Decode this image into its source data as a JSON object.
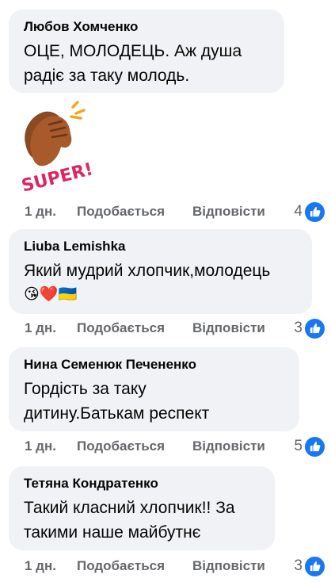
{
  "comments": [
    {
      "author": "Любов Хомченко",
      "text": "ОЦЕ, МОЛОДЕЦЬ. Аж душа радіє за таку молодь.",
      "sticker_text": "SUPER!",
      "time": "1 дн.",
      "like": "Подобається",
      "reply": "Відповісти",
      "reactions": "4"
    },
    {
      "author": "Liuba Lemishka",
      "text": "Який мудрий хлопчик,молодець",
      "emojis": "😘❤️🇺🇦",
      "time": "1 дн.",
      "like": "Подобається",
      "reply": "Відповісти",
      "reactions": "3"
    },
    {
      "author": "Нина Семенюк Печененко",
      "text": "Гордість за таку дитину.Батькам респект",
      "time": "1 дн.",
      "like": "Подобається",
      "reply": "Відповісти",
      "reactions": "5"
    },
    {
      "author": "Тетяна Кондратенко",
      "text": "Такий класний хлопчик!! За такими наше майбутнє",
      "time": "1 дн.",
      "like": "Подобається",
      "reply": "Відповісти",
      "reactions": "3"
    }
  ],
  "colors": {
    "bubble": "#f0f2f5",
    "secondary_text": "#65676b",
    "like_blue": "#1877f2"
  }
}
